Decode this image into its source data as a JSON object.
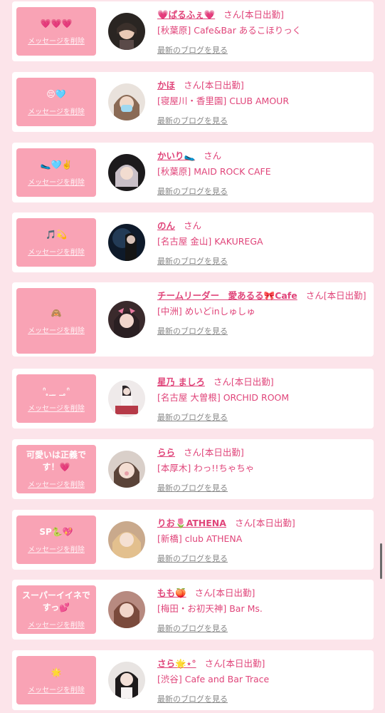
{
  "delete_label": "メッセージを削除",
  "san_label": "さん",
  "blog_label": "最新のブログを見る",
  "colors": {
    "accent": "#e0457a",
    "badge": "#f9a3b5",
    "page_bg": "#fce4ea"
  },
  "items": [
    {
      "message": "💗💗💗",
      "name": "💗ぱるふぇ💗",
      "status": "[本日出勤]",
      "shop": "[秋葉原] Cafe&Bar あるこほりっく"
    },
    {
      "message": "😔🩵",
      "name": "かほ",
      "status": "[本日出勤]",
      "shop": "[寝屋川・香里園] CLUB AMOUR"
    },
    {
      "message": "🥿🩵✌️",
      "name": "かいり🥿",
      "status": "",
      "shop": "[秋葉原] MAID ROCK CAFE"
    },
    {
      "message": "🎵💫",
      "name": "のん",
      "status": "",
      "shop": "[名古屋 金山] KAKUREGA"
    },
    {
      "message": "🙈",
      "name": "チームリーダー　愛あるる🎀Cafe",
      "status": "[本日出勤]",
      "shop": "[中洲] めいどinしゅしゅ"
    },
    {
      "message": "ᐢ ̥_ ̫ _ ̥ᐢ",
      "name": "星乃 ましろ",
      "status": "[本日出勤]",
      "shop": "[名古屋 大曽根] ORCHID ROOM"
    },
    {
      "message": "可愛いは正義です！💗",
      "name": "らら",
      "status": "[本日出勤]",
      "shop": "[本厚木] わっ!!ちゃちゃ"
    },
    {
      "message": "SP🐍💖",
      "name": "りお🌷ATHENA",
      "status": "[本日出勤]",
      "shop": "[新橋] club ATHENA"
    },
    {
      "message": "スーパーイイネですっ💕",
      "name": "もも🍑",
      "status": "[本日出勤]",
      "shop": "[梅田・お初天神] Bar Ms."
    },
    {
      "message": "🌟",
      "name": "さら🌟⋆°",
      "status": "[本日出勤]",
      "shop": "[渋谷] Cafe and Bar Trace"
    }
  ]
}
